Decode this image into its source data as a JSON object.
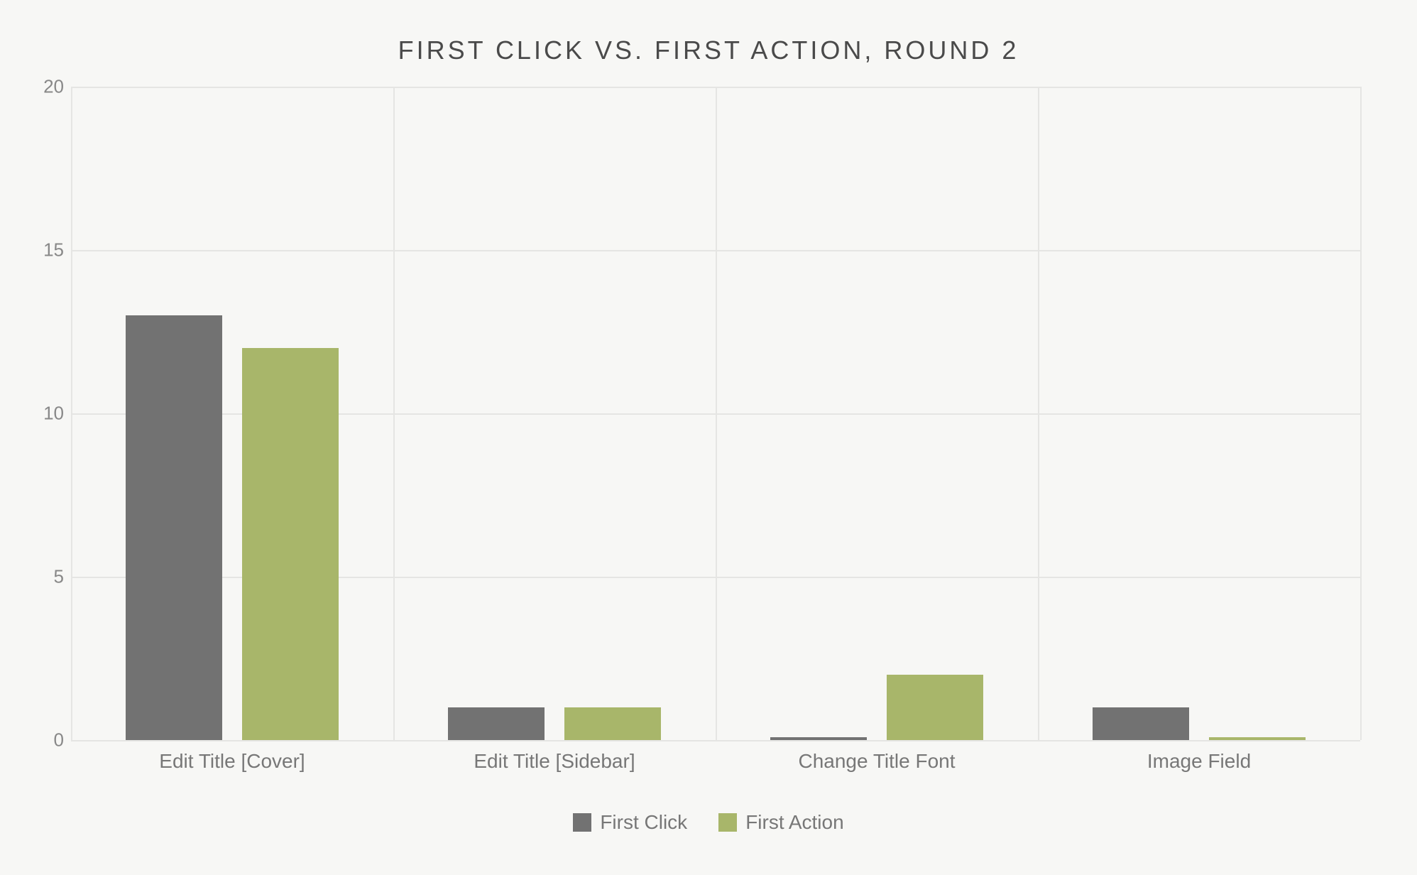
{
  "chart_data": {
    "type": "bar",
    "title": "FIRST CLICK VS. FIRST ACTION, ROUND 2",
    "xlabel": "",
    "ylabel": "",
    "ylim": [
      0,
      20
    ],
    "yticks": [
      0,
      5,
      10,
      15,
      20
    ],
    "categories": [
      "Edit Title [Cover]",
      "Edit Title [Sidebar]",
      "Change Title Font",
      "Image Field"
    ],
    "series": [
      {
        "name": "First Click",
        "color": "#727272",
        "values": [
          13,
          1,
          0,
          1
        ]
      },
      {
        "name": "First Action",
        "color": "#a8b66a",
        "values": [
          12,
          1,
          2,
          0
        ]
      }
    ],
    "legend_position": "bottom",
    "grid": true
  }
}
